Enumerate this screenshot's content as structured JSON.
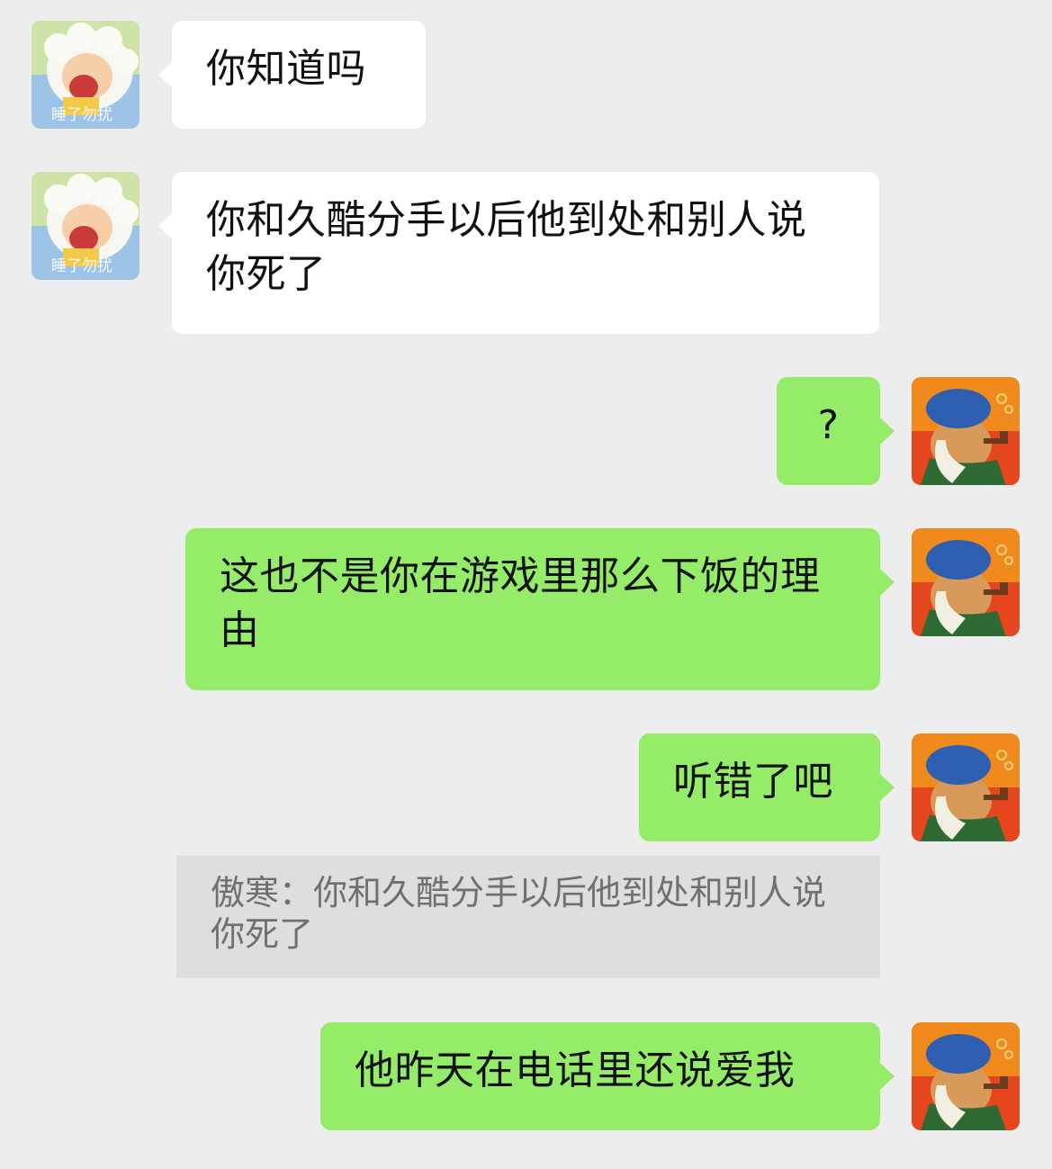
{
  "contact": {
    "name": "傲寒",
    "avatar_caption": "睡了勿扰"
  },
  "messages": [
    {
      "side": "in",
      "text": "你知道吗"
    },
    {
      "side": "in",
      "text": "你和久酷分手以后他到处和别人说你死了"
    },
    {
      "side": "out",
      "text": "?"
    },
    {
      "side": "out",
      "text": "这也不是你在游戏里那么下饭的理由"
    },
    {
      "side": "out",
      "text": "听错了吧"
    },
    {
      "side": "out",
      "text": "他昨天在电话里还说爱我"
    }
  ],
  "quote": {
    "author": "傲寒",
    "separator": "：",
    "text": "你和久酷分手以后他到处和别人说你死了"
  },
  "colors": {
    "background": "#ededed",
    "incoming_bubble": "#ffffff",
    "outgoing_bubble": "#95ec69",
    "quote_bg": "#dedede"
  }
}
